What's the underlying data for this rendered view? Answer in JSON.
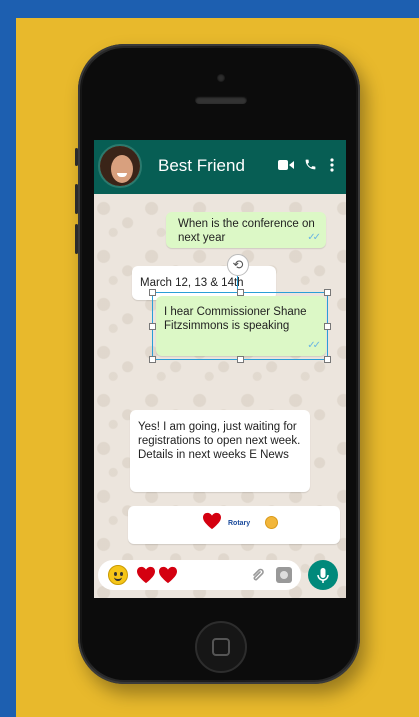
{
  "chat": {
    "contact_name": "Best Friend",
    "video_icon": "video-camera-icon",
    "call_icon": "phone-icon",
    "menu_icon": "more-vertical-icon"
  },
  "messages": [
    {
      "direction": "outgoing",
      "text": "When is the conference on next year",
      "read": true
    },
    {
      "direction": "incoming",
      "text": "March 12, 13 & 14th"
    },
    {
      "direction": "outgoing",
      "text": "I hear Commissioner Shane Fitzsimmons is speaking",
      "read": true,
      "selected": true
    },
    {
      "direction": "incoming",
      "text": "Yes! I am going, just waiting for registrations to open next week. Details in next weeks E News"
    },
    {
      "direction": "incoming",
      "content": "heart-and-rotary-logo",
      "logo_text": "Rotary"
    }
  ],
  "input_bar": {
    "emoji_icon": "smiley-emoji-icon",
    "draft_content": "two-red-hearts",
    "attach_icon": "paperclip-icon",
    "camera_icon": "camera-icon",
    "mic_icon": "microphone-icon"
  },
  "colors": {
    "page_background": "#1d5fb0",
    "panel": "#e8b92c",
    "header": "#075e54",
    "outgoing_bubble": "#dcf8c6",
    "incoming_bubble": "#ffffff",
    "heart": "#d40010",
    "mic_button": "#00897b"
  }
}
